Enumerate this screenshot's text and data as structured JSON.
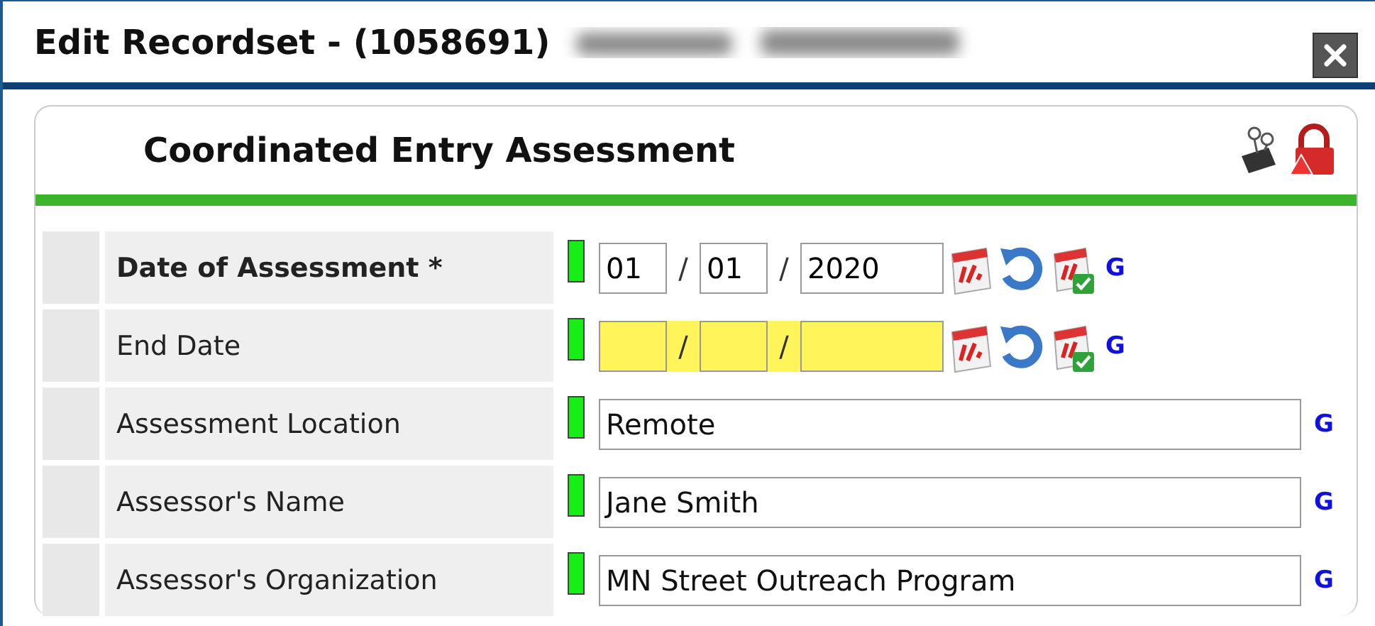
{
  "window": {
    "title": "Edit Recordset - (1058691)"
  },
  "panel": {
    "title": "Coordinated Entry Assessment"
  },
  "fields": [
    {
      "kind": "date",
      "label": "Date of Assessment *",
      "required": true,
      "highlighted": false,
      "month": "01",
      "day": "01",
      "year": "2020",
      "separator": "/",
      "link": "G"
    },
    {
      "kind": "date",
      "label": "End Date",
      "required": false,
      "highlighted": true,
      "separator": "/",
      "link": "G"
    },
    {
      "kind": "text",
      "label": "Assessment Location",
      "required": false,
      "value": "Remote",
      "link": "G"
    },
    {
      "kind": "text",
      "label": "Assessor's Name",
      "required": false,
      "value": "Jane Smith",
      "link": "G"
    },
    {
      "kind": "text",
      "label": "Assessor's Organization",
      "required": false,
      "value": "MN Street Outreach Program",
      "link": "G"
    }
  ]
}
